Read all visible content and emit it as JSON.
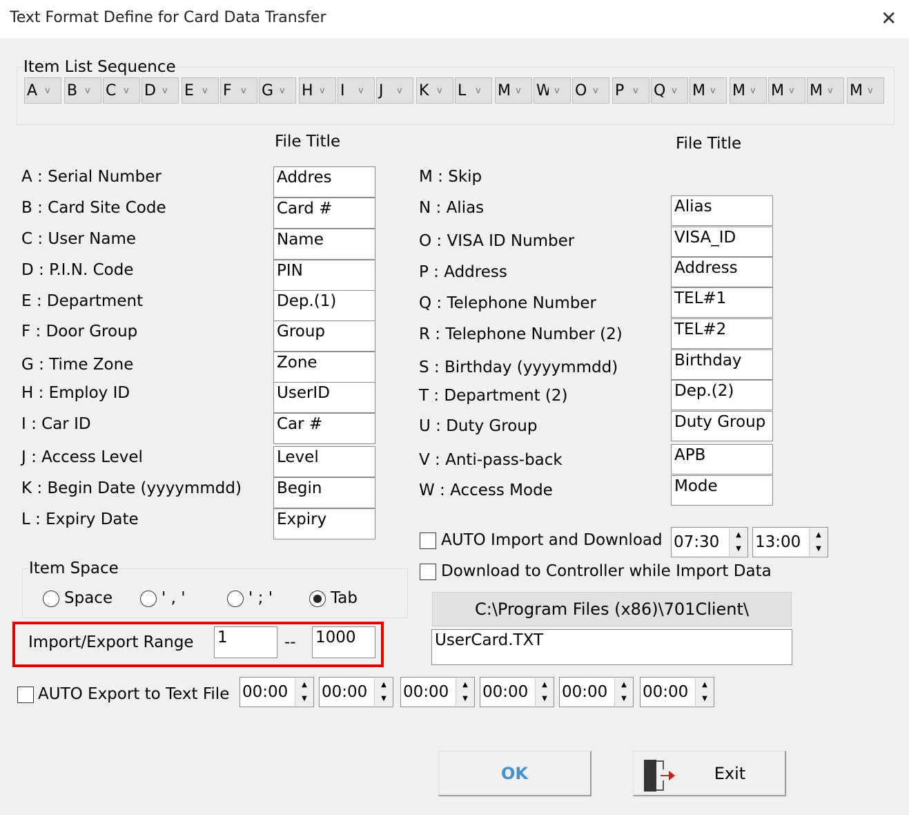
{
  "window": {
    "title": "Text Format Define for Card Data Transfer"
  },
  "sequence": {
    "label": "Item List Sequence",
    "items": [
      "A",
      "B",
      "C",
      "D",
      "E",
      "F",
      "G",
      "H",
      "I",
      "J",
      "K",
      "L",
      "M",
      "W",
      "O",
      "P",
      "Q",
      "M",
      "M",
      "M",
      "M",
      "M"
    ]
  },
  "left": {
    "header": "File Title",
    "rows": [
      {
        "label": "A : Serial Number",
        "value": "Addres"
      },
      {
        "label": "B : Card Site Code",
        "value": "Card #"
      },
      {
        "label": "C : User Name",
        "value": "Name"
      },
      {
        "label": "D : P.I.N. Code",
        "value": "PIN"
      },
      {
        "label": "E : Department",
        "value": "Dep.(1)"
      },
      {
        "label": "F : Door Group",
        "value": "Group"
      },
      {
        "label": "G : Time Zone",
        "value": "Zone"
      },
      {
        "label": "H : Employ ID",
        "value": "UserID"
      },
      {
        "label": "I  : Car ID",
        "value": "Car #"
      },
      {
        "label": "J : Access Level",
        "value": "Level"
      },
      {
        "label": "K : Begin Date (yyyymmdd)",
        "value": "Begin"
      },
      {
        "label": "L : Expiry Date",
        "value": "Expiry"
      }
    ]
  },
  "right": {
    "header": "File Title",
    "skip_label": "M : Skip",
    "rows": [
      {
        "label": "N : Alias",
        "value": "Alias"
      },
      {
        "label": "O : VISA ID Number",
        "value": "VISA_ID"
      },
      {
        "label": "P : Address",
        "value": "Address"
      },
      {
        "label": "Q : Telephone Number",
        "value": "TEL#1"
      },
      {
        "label": "R : Telephone Number (2)",
        "value": "TEL#2"
      },
      {
        "label": "S : Birthday  (yyyymmdd)",
        "value": "Birthday"
      },
      {
        "label": "T : Department (2)",
        "value": "Dep.(2)"
      },
      {
        "label": "U : Duty Group",
        "value": "Duty Group"
      },
      {
        "label": "V : Anti-pass-back",
        "value": "APB"
      },
      {
        "label": "W : Access Mode",
        "value": "Mode"
      }
    ]
  },
  "item_space": {
    "label": "Item Space",
    "options": [
      "Space",
      "' , '",
      "' ; '",
      "Tab"
    ],
    "selected": "Tab"
  },
  "range": {
    "label": "Import/Export Range",
    "from": "1",
    "sep": "--",
    "to": "1000",
    "highlight_color": "#e00000"
  },
  "auto_import": {
    "label": "AUTO Import and Download",
    "checked": false,
    "time1": "07:30",
    "time2": "13:00"
  },
  "download_ctrl": {
    "label": "Download to Controller while Import Data",
    "checked": false
  },
  "path_button": "C:\\Program Files (x86)\\701Client\\",
  "file_name": "UserCard.TXT",
  "auto_export": {
    "label": "AUTO Export to Text File",
    "checked": false,
    "times": [
      "00:00",
      "00:00",
      "00:00",
      "00:00",
      "00:00",
      "00:00"
    ]
  },
  "buttons": {
    "ok": "OK",
    "exit": "Exit"
  }
}
